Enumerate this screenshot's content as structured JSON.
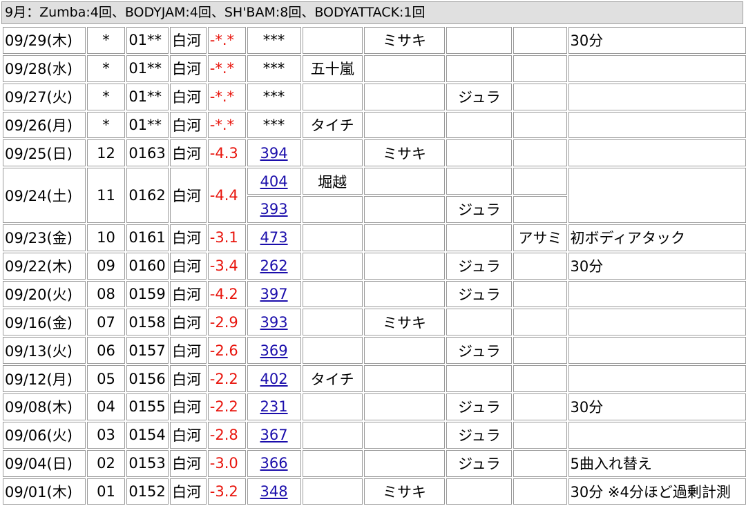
{
  "header": {
    "summary": "9月：Zumba:4回、BODYJAM:4回、SH'BAM:8回、BODYATTACK:1回"
  },
  "colors": {
    "value_red": "#e8140c",
    "link_blue": "#1a0dab",
    "header_bg": "#e0e0e0"
  },
  "rows": [
    {
      "date": "09/29(木)",
      "num": "*",
      "code": "01**",
      "place": "白河",
      "delta": "-*.*",
      "lessons": [
        {
          "id": "***",
          "link": false,
          "c6": "",
          "c7": "ミサキ",
          "c8": "",
          "c9": ""
        }
      ],
      "note": "30分"
    },
    {
      "date": "09/28(水)",
      "num": "*",
      "code": "01**",
      "place": "白河",
      "delta": "-*.*",
      "lessons": [
        {
          "id": "***",
          "link": false,
          "c6": "五十嵐",
          "c7": "",
          "c8": "",
          "c9": ""
        }
      ],
      "note": ""
    },
    {
      "date": "09/27(火)",
      "num": "*",
      "code": "01**",
      "place": "白河",
      "delta": "-*.*",
      "lessons": [
        {
          "id": "***",
          "link": false,
          "c6": "",
          "c7": "",
          "c8": "ジュラ",
          "c9": ""
        }
      ],
      "note": ""
    },
    {
      "date": "09/26(月)",
      "num": "*",
      "code": "01**",
      "place": "白河",
      "delta": "-*.*",
      "lessons": [
        {
          "id": "***",
          "link": false,
          "c6": "タイチ",
          "c7": "",
          "c8": "",
          "c9": ""
        }
      ],
      "note": ""
    },
    {
      "date": "09/25(日)",
      "num": "12",
      "code": "0163",
      "place": "白河",
      "delta": "-4.3",
      "lessons": [
        {
          "id": "394",
          "link": true,
          "c6": "",
          "c7": "ミサキ",
          "c8": "",
          "c9": ""
        }
      ],
      "note": ""
    },
    {
      "date": "09/24(土)",
      "num": "11",
      "code": "0162",
      "place": "白河",
      "delta": "-4.4",
      "lessons": [
        {
          "id": "404",
          "link": true,
          "c6": "堀越",
          "c7": "",
          "c8": "",
          "c9": ""
        },
        {
          "id": "393",
          "link": true,
          "c6": "",
          "c7": "",
          "c8": "ジュラ",
          "c9": ""
        }
      ],
      "note": ""
    },
    {
      "date": "09/23(金)",
      "num": "10",
      "code": "0161",
      "place": "白河",
      "delta": "-3.1",
      "lessons": [
        {
          "id": "473",
          "link": true,
          "c6": "",
          "c7": "",
          "c8": "",
          "c9": "アサミ"
        }
      ],
      "note": "初ボディアタック"
    },
    {
      "date": "09/22(木)",
      "num": "09",
      "code": "0160",
      "place": "白河",
      "delta": "-3.4",
      "lessons": [
        {
          "id": "262",
          "link": true,
          "c6": "",
          "c7": "",
          "c8": "ジュラ",
          "c9": ""
        }
      ],
      "note": "30分"
    },
    {
      "date": "09/20(火)",
      "num": "08",
      "code": "0159",
      "place": "白河",
      "delta": "-4.2",
      "lessons": [
        {
          "id": "397",
          "link": true,
          "c6": "",
          "c7": "",
          "c8": "ジュラ",
          "c9": ""
        }
      ],
      "note": ""
    },
    {
      "date": "09/16(金)",
      "num": "07",
      "code": "0158",
      "place": "白河",
      "delta": "-2.9",
      "lessons": [
        {
          "id": "393",
          "link": true,
          "c6": "",
          "c7": "ミサキ",
          "c8": "",
          "c9": ""
        }
      ],
      "note": ""
    },
    {
      "date": "09/13(火)",
      "num": "06",
      "code": "0157",
      "place": "白河",
      "delta": "-2.6",
      "lessons": [
        {
          "id": "369",
          "link": true,
          "c6": "",
          "c7": "",
          "c8": "ジュラ",
          "c9": ""
        }
      ],
      "note": ""
    },
    {
      "date": "09/12(月)",
      "num": "05",
      "code": "0156",
      "place": "白河",
      "delta": "-2.2",
      "lessons": [
        {
          "id": "402",
          "link": true,
          "c6": "タイチ",
          "c7": "",
          "c8": "",
          "c9": ""
        }
      ],
      "note": ""
    },
    {
      "date": "09/08(木)",
      "num": "04",
      "code": "0155",
      "place": "白河",
      "delta": "-2.2",
      "lessons": [
        {
          "id": "231",
          "link": true,
          "c6": "",
          "c7": "",
          "c8": "ジュラ",
          "c9": ""
        }
      ],
      "note": "30分"
    },
    {
      "date": "09/06(火)",
      "num": "03",
      "code": "0154",
      "place": "白河",
      "delta": "-2.8",
      "lessons": [
        {
          "id": "367",
          "link": true,
          "c6": "",
          "c7": "",
          "c8": "ジュラ",
          "c9": ""
        }
      ],
      "note": ""
    },
    {
      "date": "09/04(日)",
      "num": "02",
      "code": "0153",
      "place": "白河",
      "delta": "-3.0",
      "lessons": [
        {
          "id": "366",
          "link": true,
          "c6": "",
          "c7": "",
          "c8": "ジュラ",
          "c9": ""
        }
      ],
      "note": "5曲入れ替え"
    },
    {
      "date": "09/01(木)",
      "num": "01",
      "code": "0152",
      "place": "白河",
      "delta": "-3.2",
      "lessons": [
        {
          "id": "348",
          "link": true,
          "c6": "",
          "c7": "ミサキ",
          "c8": "",
          "c9": ""
        }
      ],
      "note": "30分 ※4分ほど過剰計測"
    }
  ]
}
